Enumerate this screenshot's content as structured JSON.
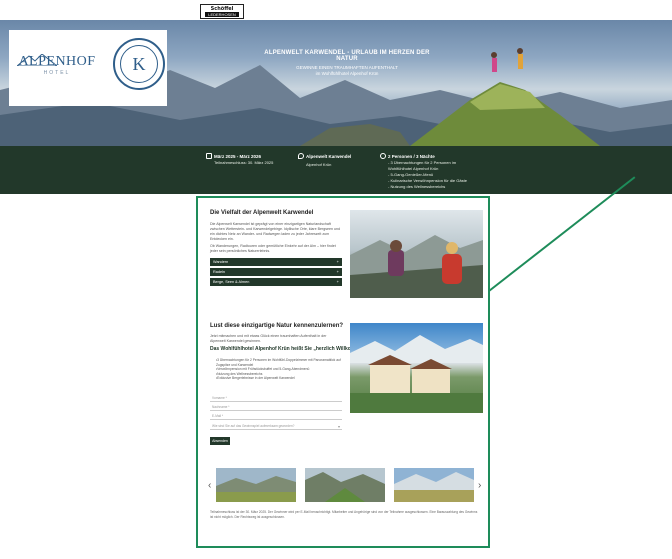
{
  "brand_logo": {
    "line1": "Schöffel",
    "line2": "LEDERHOSEN"
  },
  "hero": {
    "logo_name": "ALPENHOF",
    "logo_sub": "HOTEL",
    "seal_letter": "K",
    "headline": "ALPENWELT KARWENDEL - URLAUB IM HERZEN DER NATUR",
    "subline1": "GEWINNE EINEN TRAUMHAFTEN AUFENTHALT",
    "subline2": "im Wohlfühlhotel Alpenhof Krün"
  },
  "infobar": {
    "date_title": "März 2025 - März 2026",
    "date_sub": "Teilnahmeschluss: 30. März 2025",
    "place_title": "Alpenwelt Karwendel",
    "place_sub": "Alpenhof Krün",
    "people_title": "2 Personen / 3 Nächte",
    "people_items": [
      "3 Übernachtungen für 2 Personen im Wohlfühlhotel Alpenhof Krün",
      "5-Gang-Genießer-Menü",
      "Kulinarische Verwöhnpension für die Gäste",
      "Nutzung des Wellnessbereichs"
    ]
  },
  "section1": {
    "title": "Die Vielfalt der Alpenwelt Karwendel",
    "text1": "Die Alpenwelt Karwendel ist geprägt von einer einzigartigen Naturlandschaft zwischen Wetterstein- und Karwendelgebirge. Idyllische Orte, klare Bergseen und ein dichtes Netz an Wander- und Radwegen laden zu jeder Jahreszeit zum Entdecken ein.",
    "text2": "Ob Wanderungen, Radtouren oder gemütliche Einkehr auf der Alm – hier findet jeder sein persönliches Naturerlebnis.",
    "accordion": [
      "Wandern",
      "Radeln",
      "Berge, Seen & Almen"
    ]
  },
  "section2": {
    "title": "Lust diese einzigartige Natur kennenzulernen?",
    "intro": "Jetzt mitmachen und mit etwas Glück einen traumhaften Aufenthalt in der Alpenwelt Karwendel gewinnen.",
    "subtitle": "Das Wohlfühlhotel Alpenhof Krün heißt Sie „herzlich Willkommen“ zu:",
    "bullets": [
      "3 Übernachtungen für 2 Personen im Wohlfühl-Doppelzimmer mit Panoramablick auf Zugspitze und Karwendel",
      "Verwöhnpension mit Frühstücksbuffet und 5-Gang-Abendmenü",
      "Nutzung des Wellnessbereichs",
      "Exklusive Bergerlebnisse in der Alpenwelt Karwendel"
    ],
    "fields": [
      "Vorname *",
      "Nachname *",
      "E-Mail *",
      "Wie sind Sie auf das Gewinnspiel aufmerksam geworden?"
    ],
    "submit_label": "Absenden"
  },
  "footer": {
    "text": "Teilnahmeschluss ist der 30. März 2025. Der Gewinner wird per E-Mail benachrichtigt. Mitarbeiter und Angehörige sind von der Teilnahme ausgeschlossen. Eine Barauszahlung des Gewinns ist nicht möglich. Der Rechtsweg ist ausgeschlossen.",
    "prev_arrow": "‹",
    "next_arrow": "›"
  },
  "colors": {
    "forest_green": "#22382a",
    "accent_green": "#1e8c5a",
    "brand_blue": "#2f5e8a"
  },
  "icons": [
    "calendar-icon",
    "location-pin-icon",
    "people-icon",
    "chevron-left-icon",
    "chevron-right-icon"
  ]
}
